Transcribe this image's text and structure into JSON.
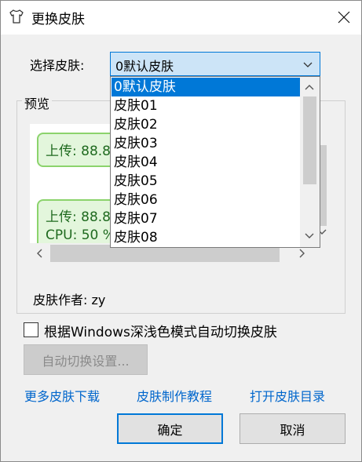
{
  "window": {
    "title": "更换皮肤"
  },
  "skin_select": {
    "label": "选择皮肤:",
    "value": "0默认皮肤",
    "options": [
      "0默认皮肤",
      "皮肤01",
      "皮肤02",
      "皮肤03",
      "皮肤04",
      "皮肤05",
      "皮肤06",
      "皮肤07",
      "皮肤08"
    ],
    "selected_index": 0
  },
  "preview": {
    "label": "预览",
    "line1": "上传: 88.8",
    "line2": "上传: 88.8",
    "line3": "CPU: 50 %"
  },
  "author": "皮肤作者: zy",
  "auto_switch": {
    "checkbox_label": "根据Windows深浅色模式自动切换皮肤",
    "checked": false,
    "settings_button": "自动切换设置..."
  },
  "links": {
    "more": "更多皮肤下载",
    "tutorial": "皮肤制作教程",
    "open_dir": "打开皮肤目录"
  },
  "buttons": {
    "ok": "确定",
    "cancel": "取消"
  },
  "colors": {
    "accent": "#0078d7",
    "link": "#0066cc",
    "bubble_fill": "#e3f6dc",
    "bubble_border": "#8bd36c"
  }
}
